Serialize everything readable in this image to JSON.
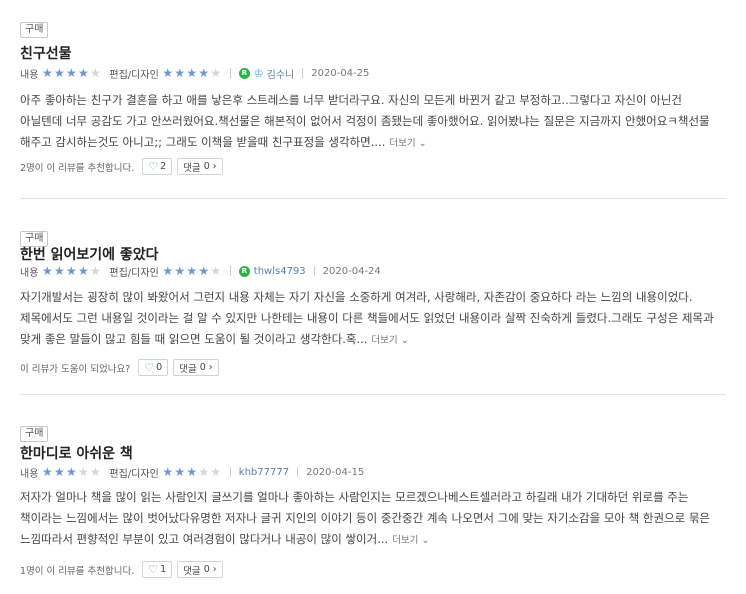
{
  "labels": {
    "content": "내용",
    "design": "편집/디자인",
    "more": "더보기",
    "comment": "댓글"
  },
  "reviews": [
    {
      "badge": "구매",
      "title": "친구선물",
      "content_stars": "★★★★☆",
      "design_stars": "★★★★☆",
      "content_rating": 4,
      "design_rating": 4,
      "user": "김수니",
      "date": "2020-04-25",
      "body": "아주 좋아하는 친구가 결혼을 하고 애를 낳은후 스트레스를 너무 받더라구요. 자신의 모든게 바뀐거 같고 부정하고..그렇다고 자신이 아닌건 아닐텐데 너무 공감도 가고 안쓰러웠어요.책선물은 해본적이 없어서 걱정이 좀됐는데 좋아했어요. 읽어봤냐는 질문은 지금까지 안했어요ㅋ책선물 해주고 감시하는것도 아니고;; 그래도 이책을 받을때 친구표정을 생각하면....",
      "recommend_text": "2명이 이 리뷰를 추천합니다.",
      "likes": "2",
      "comments": "0"
    },
    {
      "badge": "구매",
      "title": "한번 읽어보기에 좋았다",
      "content_stars": "★★★★☆",
      "design_stars": "★★★★☆",
      "content_rating": 4,
      "design_rating": 4,
      "user": "thwls4793",
      "date": "2020-04-24",
      "body": "자기개발서는 굉장히 많이 봐왔어서 그런지 내용 자체는 자기 자신을 소중하게 여겨라, 사랑해라, 자존감이 중요하다 라는 느낌의 내용이었다. 제목에서도 그런 내용일 것이라는 걸 알 수 있지만 나한테는 내용이 다른 책들에서도 읽었던 내용이라 살짝 진숙하게 들렸다.그래도 구성은 제목과 맞게 좋은 말들이 많고 힘들 때 읽으면 도움이 될 것이라고 생각한다.혹...",
      "recommend_text": "이 리뷰가 도움이 되었나요?",
      "likes": "0",
      "comments": "0"
    },
    {
      "badge": "구매",
      "title": "한마디로 아쉬운 책",
      "content_stars": "★★★☆☆",
      "design_stars": "★★★☆☆",
      "content_rating": 3,
      "design_rating": 3,
      "user": "khb77777",
      "date": "2020-04-15",
      "body": "저자가 얼마나 책을 많이 읽는 사람인지 글쓰기를 얼마나 좋아하는 사람인지는 모르겠으나베스트셀러라고 하길래 내가 기대하던 위로를 주는 책이라는 느낌에서는 많이 벗어났다유명한 저자나 글귀 지인의 이야기 등이 중간중간 계속 나오면서 그에 맞는 자기소감을 모아 책 한권으로 묶은 느낌따라서 편향적인 부분이 있고 여러경험이 많다거나 내공이 많이 쌓이거...",
      "recommend_text": "1명이 이 리뷰를 추천합니다.",
      "likes": "1",
      "comments": "0"
    }
  ]
}
